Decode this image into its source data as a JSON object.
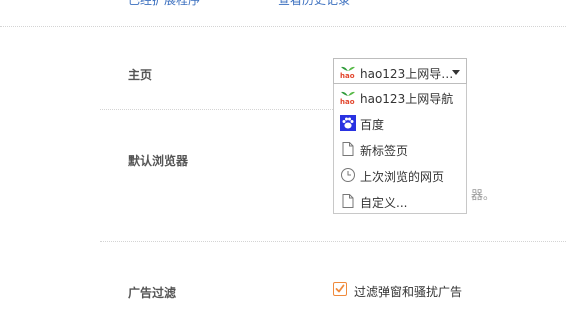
{
  "top_links": {
    "left_label": "已经扩展程序",
    "right_label": "查看历史记录"
  },
  "homepage": {
    "label": "主页",
    "selected_value": "hao123上网导…",
    "options": [
      {
        "label": "hao123上网导航",
        "icon": "hao123-icon"
      },
      {
        "label": "百度",
        "icon": "baidu-paw-icon"
      },
      {
        "label": "新标签页",
        "icon": "page-icon"
      },
      {
        "label": "上次浏览的网页",
        "icon": "clock-icon"
      },
      {
        "label": "自定义...",
        "icon": "page-icon"
      }
    ]
  },
  "default_browser": {
    "label": "默认浏览器",
    "hint_fragment": "器。"
  },
  "ad_filter": {
    "label": "广告过滤",
    "checkbox_label": "过滤弹窗和骚扰广告",
    "checked": true
  },
  "colors": {
    "link": "#3b6fbf",
    "checkbox_accent": "#f08a3c",
    "baidu_blue": "#2932e1",
    "hao_green": "#2e9b3a",
    "hao_red": "#e2462d"
  }
}
